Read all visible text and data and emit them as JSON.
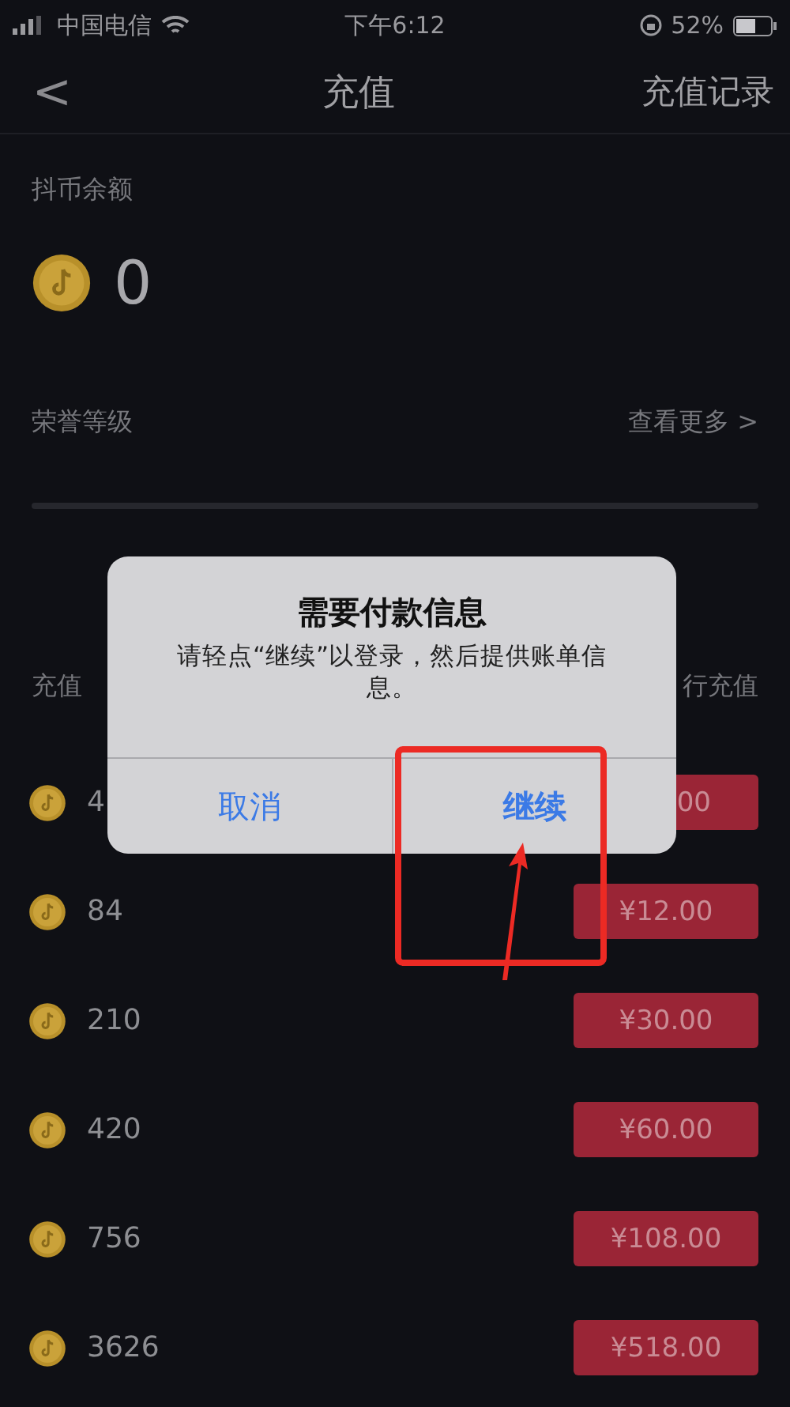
{
  "status_bar": {
    "carrier": "中国电信",
    "time": "下午6:12",
    "battery": "52%"
  },
  "nav": {
    "back": "<",
    "title": "充值",
    "action": "充值记录"
  },
  "balance": {
    "label": "抖币余额",
    "value": "0"
  },
  "honor": {
    "label": "荣誉等级",
    "more": "查看更多",
    "more_arrow": ">"
  },
  "recharge_header": {
    "left": "充值",
    "right": "行充值"
  },
  "packages": [
    {
      "coins": "4",
      "price": "00"
    },
    {
      "coins": "84",
      "price": "¥12.00"
    },
    {
      "coins": "210",
      "price": "¥30.00"
    },
    {
      "coins": "420",
      "price": "¥60.00"
    },
    {
      "coins": "756",
      "price": "¥108.00"
    },
    {
      "coins": "3626",
      "price": "¥518.00"
    }
  ],
  "dialog": {
    "title": "需要付款信息",
    "message": "请轻点“继续”以登录，然后提供账单信息。",
    "buttons": [
      {
        "label": "取消",
        "kind": "cancel",
        "highlighted": false
      },
      {
        "label": "继续",
        "kind": "confirm",
        "highlighted": true
      }
    ]
  }
}
